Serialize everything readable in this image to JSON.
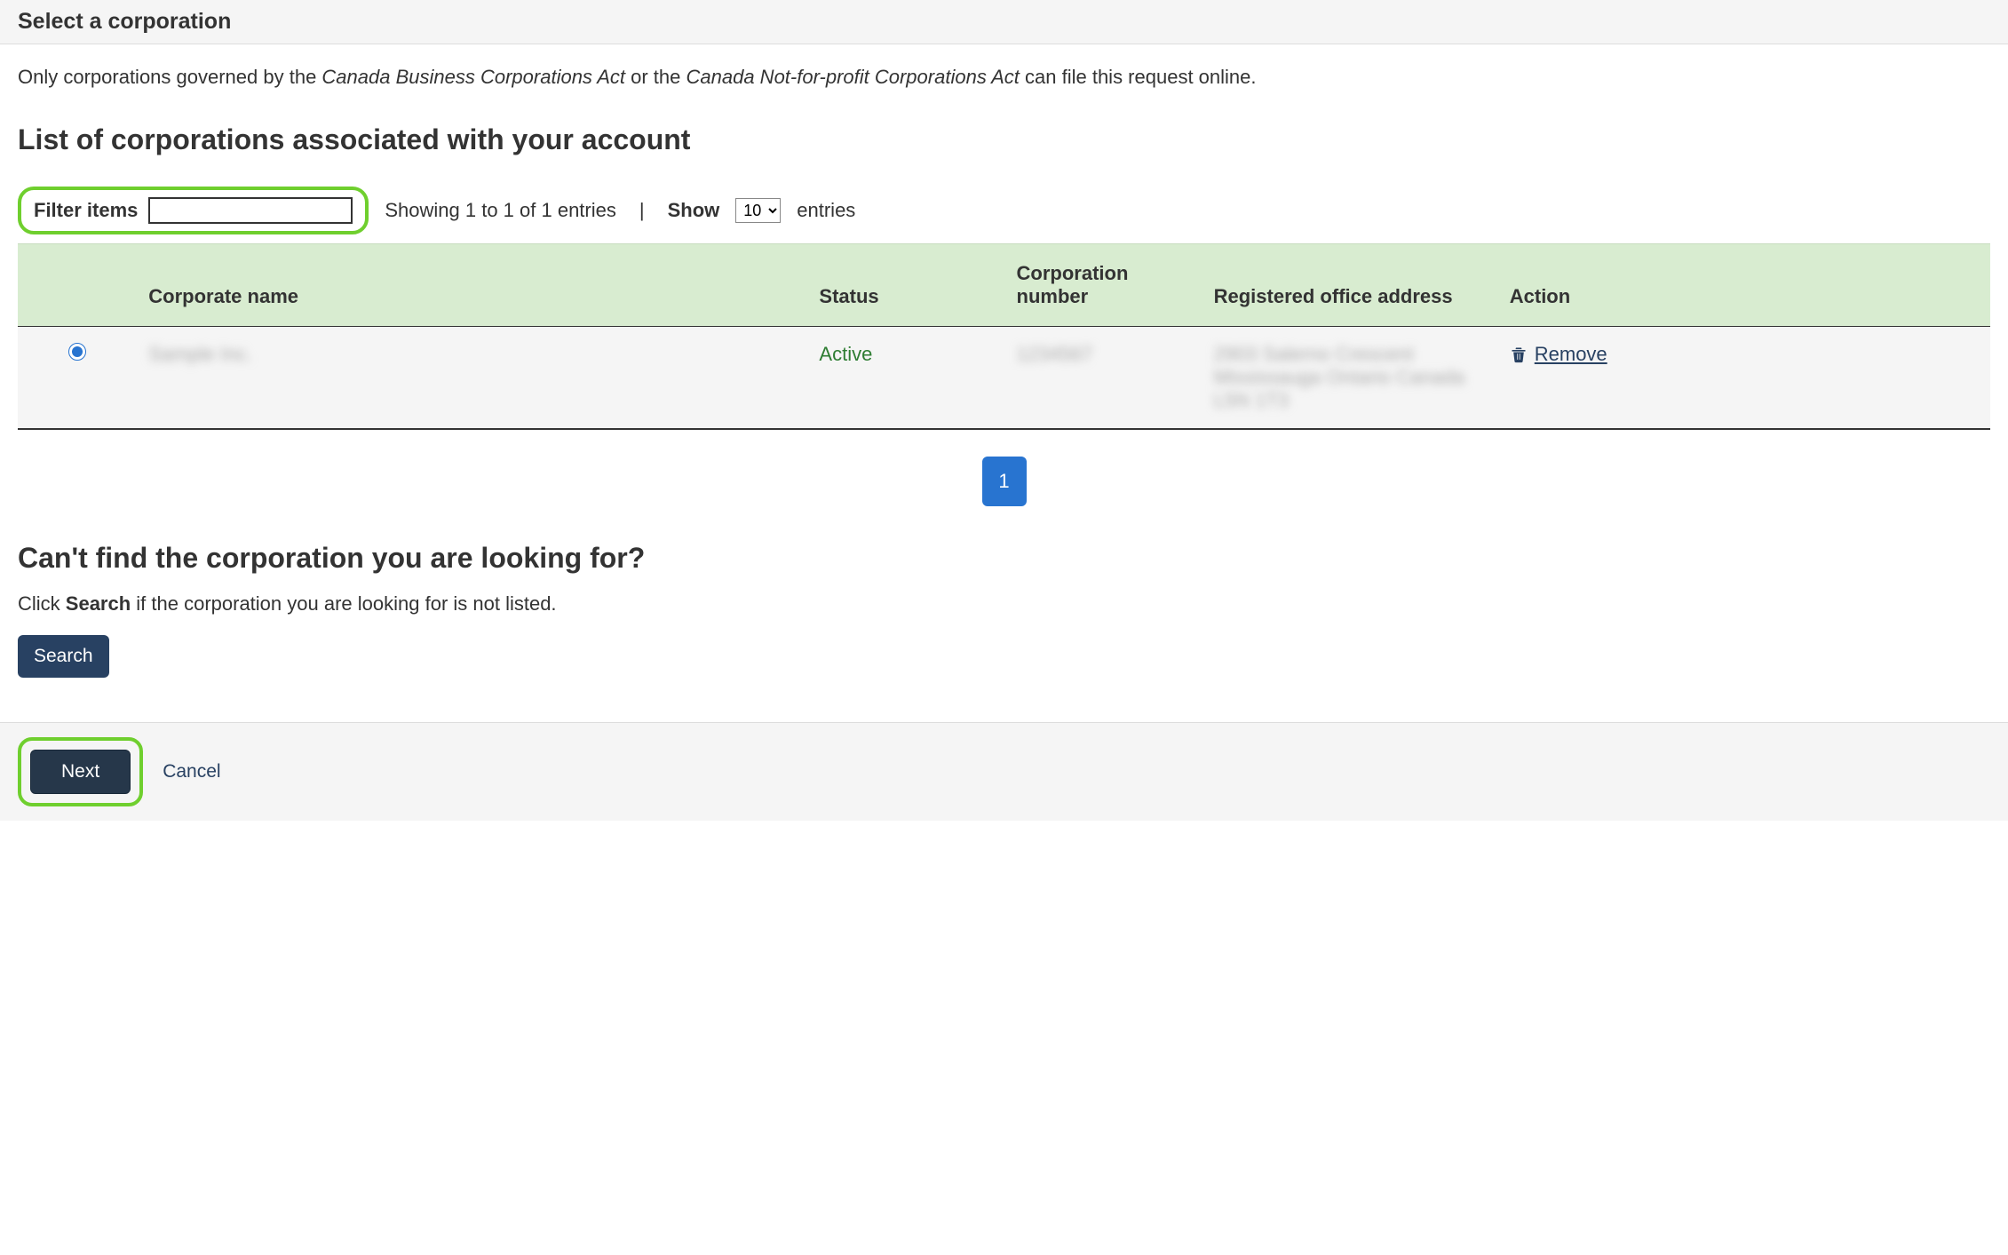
{
  "header": {
    "title": "Select a corporation"
  },
  "intro": {
    "part1": "Only corporations governed by the ",
    "act1": "Canada Business Corporations Act",
    "part2": " or the ",
    "act2": "Canada Not-for-profit Corporations Act",
    "part3": " can file this request online."
  },
  "list_heading": "List of corporations associated with your account",
  "filter": {
    "label": "Filter items"
  },
  "showing": {
    "text": "Showing 1 to 1 of 1 entries",
    "show_label": "Show",
    "entries_label": "entries",
    "selected": "10"
  },
  "table": {
    "headers": {
      "name": "Corporate name",
      "status": "Status",
      "number": "Corporation number",
      "address": "Registered office address",
      "action": "Action"
    },
    "row": {
      "name_redacted": "Sample Inc.",
      "status": "Active",
      "number_redacted": "1234567",
      "address_redacted": "2903 Salerno Crescent Mississauga Ontario Canada L5N 1T3",
      "remove_label": "Remove"
    }
  },
  "pagination": {
    "page": "1"
  },
  "cantfind": {
    "heading": "Can't find the corporation you are looking for?",
    "instr_pre": "Click ",
    "instr_bold": "Search",
    "instr_post": " if the corporation you are looking for is not listed.",
    "search_btn": "Search"
  },
  "footer": {
    "next": "Next",
    "cancel": "Cancel"
  }
}
